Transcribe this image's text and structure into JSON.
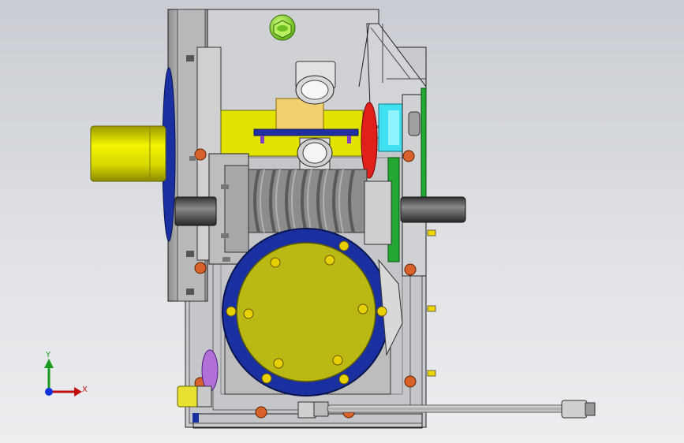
{
  "triad": {
    "y_label": "Y",
    "x_label": "X"
  },
  "colors": {
    "housing": "#c8c8c8",
    "yellow_part": "#e6e600",
    "blue_flange": "#1a2fa0",
    "olive_cover": "#b9b814",
    "red_ring": "#e0201a",
    "cyan_part": "#40e0f0",
    "green_plate": "#22a833",
    "worm_gray": "#8c8c8c",
    "bolt_orange": "#d9622a",
    "bolt_yellow": "#f0d400",
    "purple_ring": "#b070d8",
    "lime_plug": "#88e020"
  }
}
